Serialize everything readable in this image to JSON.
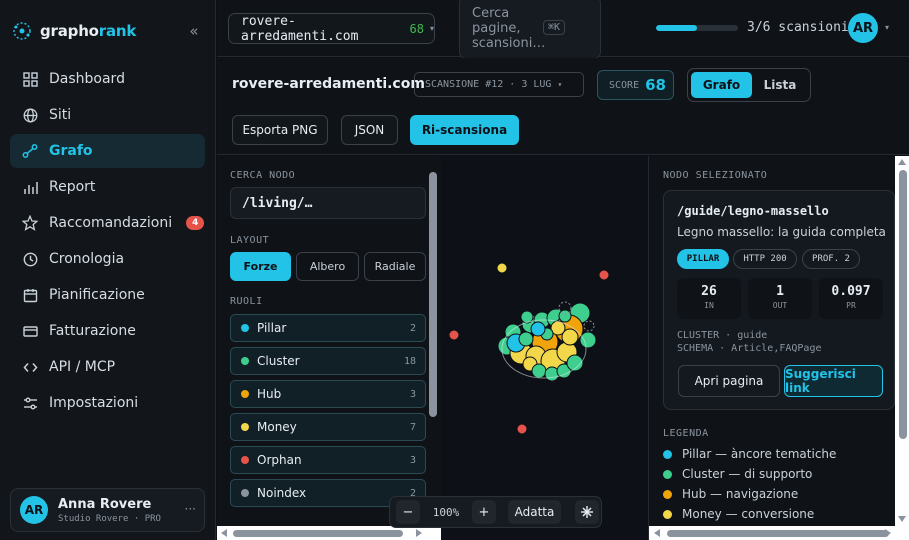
{
  "brand": {
    "name_part1": "grapho",
    "name_part2": "rank",
    "accent": "#22c3e6"
  },
  "sidebar": {
    "collapse_icon": "chevrons-left-icon",
    "items": [
      {
        "label": "Dashboard",
        "icon": "grid-icon"
      },
      {
        "label": "Siti",
        "icon": "globe-icon"
      },
      {
        "label": "Grafo",
        "icon": "graph-icon",
        "active": true
      },
      {
        "label": "Report",
        "icon": "bar-chart-icon"
      },
      {
        "label": "Raccomandazioni",
        "icon": "star-icon",
        "badge": "4"
      },
      {
        "label": "Cronologia",
        "icon": "clock-icon"
      },
      {
        "label": "Pianificazione",
        "icon": "calendar-icon"
      },
      {
        "label": "Fatturazione",
        "icon": "credit-card-icon"
      },
      {
        "label": "API / MCP",
        "icon": "code-icon"
      },
      {
        "label": "Impostazioni",
        "icon": "sliders-icon"
      }
    ],
    "user": {
      "initials": "AR",
      "name": "Anna Rovere",
      "subtitle": "Studio Rovere · PRO",
      "more": "···"
    }
  },
  "topbar": {
    "site": "rovere-arredamenti.com",
    "site_score": "68",
    "search_placeholder": "Cerca pagine, scansioni…",
    "search_shortcut": "⌘K",
    "scans_used_fraction": 0.5,
    "scans_text": "3/6 scansioni",
    "avatar_initials": "AR"
  },
  "header": {
    "title": "rovere-arredamenti.com",
    "scan_select": "SCANSIONE #12 · 3 LUG",
    "score_label": "SCORE",
    "score_value": "68",
    "view_graph": "Grafo",
    "view_list": "Lista",
    "btn_png": "Esporta PNG",
    "btn_json": "JSON",
    "btn_rescan": "Ri-scansiona"
  },
  "left": {
    "search_label": "CERCA NODO",
    "search_value": "/living/…",
    "layout_label": "LAYOUT",
    "layouts": [
      "Forze",
      "Albero",
      "Radiale"
    ],
    "roles_label": "RUOLI",
    "roles": [
      {
        "name": "Pillar",
        "count": "2",
        "color": "#22c3e6"
      },
      {
        "name": "Cluster",
        "count": "18",
        "color": "#3ecf8e"
      },
      {
        "name": "Hub",
        "count": "3",
        "color": "#f0a30a"
      },
      {
        "name": "Money",
        "count": "7",
        "color": "#f2d74a"
      },
      {
        "name": "Orphan",
        "count": "3",
        "color": "#e5534b"
      },
      {
        "name": "Noindex",
        "count": "2",
        "color": "#8b949e"
      }
    ]
  },
  "canvas": {
    "zoom": "100%",
    "fit_label": "Adatta",
    "zoom_out_icon": "minus-icon",
    "zoom_in_icon": "plus-icon",
    "center_icon": "crosshair-icon"
  },
  "node": {
    "section_label": "NODO SELEZIONATO",
    "path": "/guide/legno-massello",
    "title": "Legno massello: la guida completa",
    "chip_role": "PILLAR",
    "chip_http": "HTTP 200",
    "chip_depth": "PROF. 2",
    "in_value": "26",
    "in_label": "IN",
    "out_value": "1",
    "out_label": "OUT",
    "pr_value": "0.097",
    "pr_label": "PR",
    "meta_cluster": "CLUSTER · guide",
    "meta_schema": "SCHEMA · Article,FAQPage",
    "btn_open": "Apri pagina",
    "btn_suggest": "Suggerisci link"
  },
  "legend": {
    "label": "LEGENDA",
    "items": [
      {
        "text": "Pillar — àncore tematiche",
        "color": "#22c3e6"
      },
      {
        "text": "Cluster — di supporto",
        "color": "#3ecf8e"
      },
      {
        "text": "Hub — navigazione",
        "color": "#f0a30a"
      },
      {
        "text": "Money — conversione",
        "color": "#f2d74a"
      }
    ]
  }
}
